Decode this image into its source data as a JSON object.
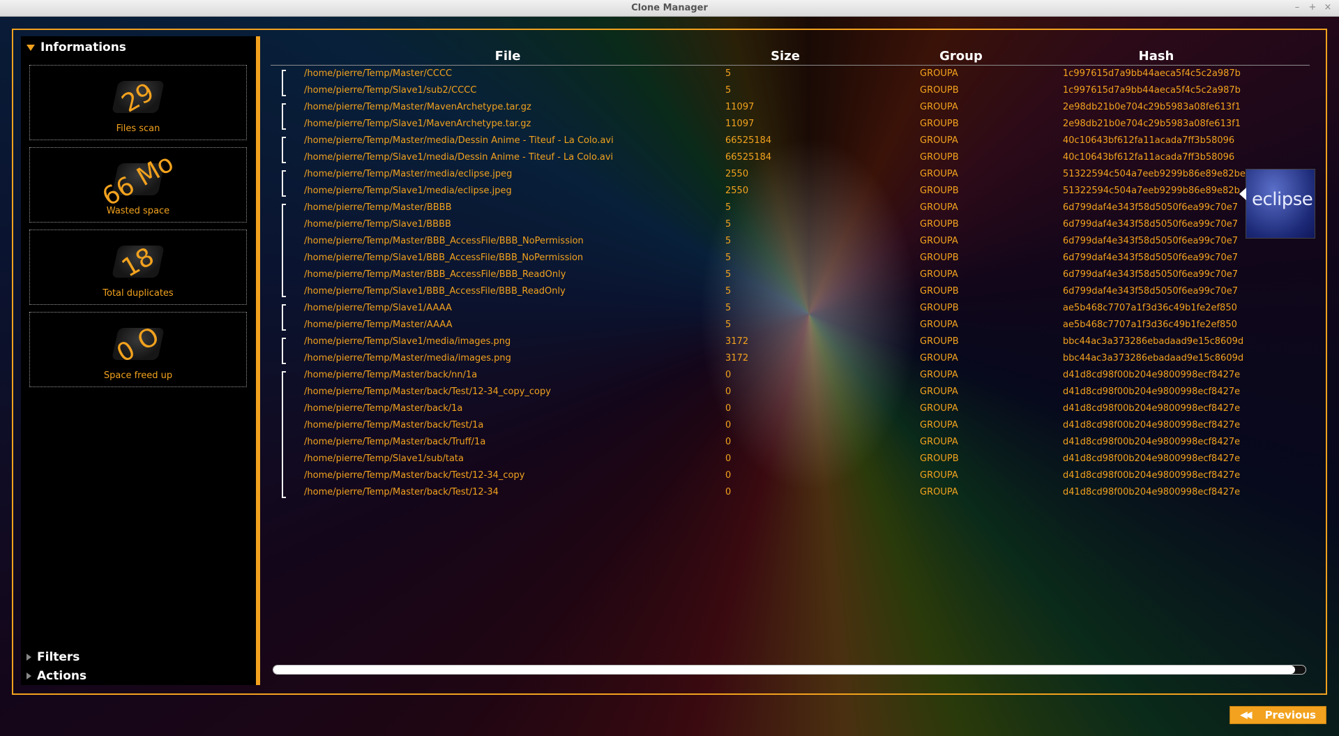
{
  "window": {
    "title": "Clone Manager",
    "controls": [
      "–",
      "+",
      "×"
    ]
  },
  "sidebar": {
    "informations_label": "Informations",
    "filters_label": "Filters",
    "actions_label": "Actions",
    "cards": [
      {
        "value": "29",
        "label": "Files scan"
      },
      {
        "value": "66 Mo",
        "label": "Wasted space"
      },
      {
        "value": "18",
        "label": "Total duplicates"
      },
      {
        "value": "0 O",
        "label": "Space freed up"
      }
    ]
  },
  "table": {
    "headers": {
      "file": "File",
      "size": "Size",
      "group": "Group",
      "hash": "Hash"
    },
    "rows": [
      {
        "file": "/home/pierre/Temp/Master/CCCC",
        "size": "5",
        "group": "GROUPA",
        "hash": "1c997615d7a9bb44aeca5f4c5c2a987b"
      },
      {
        "file": "/home/pierre/Temp/Slave1/sub2/CCCC",
        "size": "5",
        "group": "GROUPB",
        "hash": "1c997615d7a9bb44aeca5f4c5c2a987b"
      },
      {
        "file": "/home/pierre/Temp/Master/MavenArchetype.tar.gz",
        "size": "11097",
        "group": "GROUPA",
        "hash": "2e98db21b0e704c29b5983a08fe613f1"
      },
      {
        "file": "/home/pierre/Temp/Slave1/MavenArchetype.tar.gz",
        "size": "11097",
        "group": "GROUPB",
        "hash": "2e98db21b0e704c29b5983a08fe613f1"
      },
      {
        "file": "/home/pierre/Temp/Master/media/Dessin Anime - Titeuf - La Colo.avi",
        "size": "66525184",
        "group": "GROUPA",
        "hash": "40c10643bf612fa11acada7ff3b58096"
      },
      {
        "file": "/home/pierre/Temp/Slave1/media/Dessin Anime - Titeuf - La Colo.avi",
        "size": "66525184",
        "group": "GROUPB",
        "hash": "40c10643bf612fa11acada7ff3b58096"
      },
      {
        "file": "/home/pierre/Temp/Master/media/eclipse.jpeg",
        "size": "2550",
        "group": "GROUPA",
        "hash": "51322594c504a7eeb9299b86e89e82be"
      },
      {
        "file": "/home/pierre/Temp/Slave1/media/eclipse.jpeg",
        "size": "2550",
        "group": "GROUPB",
        "hash": "51322594c504a7eeb9299b86e89e82b"
      },
      {
        "file": "/home/pierre/Temp/Master/BBBB",
        "size": "5",
        "group": "GROUPA",
        "hash": "6d799daf4e343f58d5050f6ea99c70e7"
      },
      {
        "file": "/home/pierre/Temp/Slave1/BBBB",
        "size": "5",
        "group": "GROUPB",
        "hash": "6d799daf4e343f58d5050f6ea99c70e7"
      },
      {
        "file": "/home/pierre/Temp/Master/BBB_AccessFile/BBB_NoPermission",
        "size": "5",
        "group": "GROUPA",
        "hash": "6d799daf4e343f58d5050f6ea99c70e7"
      },
      {
        "file": "/home/pierre/Temp/Slave1/BBB_AccessFile/BBB_NoPermission",
        "size": "5",
        "group": "GROUPB",
        "hash": "6d799daf4e343f58d5050f6ea99c70e7"
      },
      {
        "file": "/home/pierre/Temp/Master/BBB_AccessFile/BBB_ReadOnly",
        "size": "5",
        "group": "GROUPA",
        "hash": "6d799daf4e343f58d5050f6ea99c70e7"
      },
      {
        "file": "/home/pierre/Temp/Slave1/BBB_AccessFile/BBB_ReadOnly",
        "size": "5",
        "group": "GROUPB",
        "hash": "6d799daf4e343f58d5050f6ea99c70e7"
      },
      {
        "file": "/home/pierre/Temp/Slave1/AAAA",
        "size": "5",
        "group": "GROUPB",
        "hash": "ae5b468c7707a1f3d36c49b1fe2ef850"
      },
      {
        "file": "/home/pierre/Temp/Master/AAAA",
        "size": "5",
        "group": "GROUPA",
        "hash": "ae5b468c7707a1f3d36c49b1fe2ef850"
      },
      {
        "file": "/home/pierre/Temp/Slave1/media/images.png",
        "size": "3172",
        "group": "GROUPB",
        "hash": "bbc44ac3a373286ebadaad9e15c8609d"
      },
      {
        "file": "/home/pierre/Temp/Master/media/images.png",
        "size": "3172",
        "group": "GROUPA",
        "hash": "bbc44ac3a373286ebadaad9e15c8609d"
      },
      {
        "file": "/home/pierre/Temp/Master/back/nn/1a",
        "size": "0",
        "group": "GROUPA",
        "hash": "d41d8cd98f00b204e9800998ecf8427e"
      },
      {
        "file": "/home/pierre/Temp/Master/back/Test/12-34_copy_copy",
        "size": "0",
        "group": "GROUPA",
        "hash": "d41d8cd98f00b204e9800998ecf8427e"
      },
      {
        "file": "/home/pierre/Temp/Master/back/1a",
        "size": "0",
        "group": "GROUPA",
        "hash": "d41d8cd98f00b204e9800998ecf8427e"
      },
      {
        "file": "/home/pierre/Temp/Master/back/Test/1a",
        "size": "0",
        "group": "GROUPA",
        "hash": "d41d8cd98f00b204e9800998ecf8427e"
      },
      {
        "file": "/home/pierre/Temp/Master/back/Truff/1a",
        "size": "0",
        "group": "GROUPA",
        "hash": "d41d8cd98f00b204e9800998ecf8427e"
      },
      {
        "file": "/home/pierre/Temp/Slave1/sub/tata",
        "size": "0",
        "group": "GROUPB",
        "hash": "d41d8cd98f00b204e9800998ecf8427e"
      },
      {
        "file": "/home/pierre/Temp/Master/back/Test/12-34_copy",
        "size": "0",
        "group": "GROUPA",
        "hash": "d41d8cd98f00b204e9800998ecf8427e"
      },
      {
        "file": "/home/pierre/Temp/Master/back/Test/12-34",
        "size": "0",
        "group": "GROUPA",
        "hash": "d41d8cd98f00b204e9800998ecf8427e"
      }
    ],
    "group_sizes": [
      2,
      2,
      2,
      2,
      6,
      2,
      2,
      8
    ]
  },
  "preview": {
    "logo_text": "eclipse"
  },
  "progress": {
    "fraction": 0.99
  },
  "footer": {
    "previous_label": "Previous"
  },
  "colors": {
    "accent": "#f2a21e",
    "text": "#f2a21e",
    "header_text": "#ffffff"
  }
}
